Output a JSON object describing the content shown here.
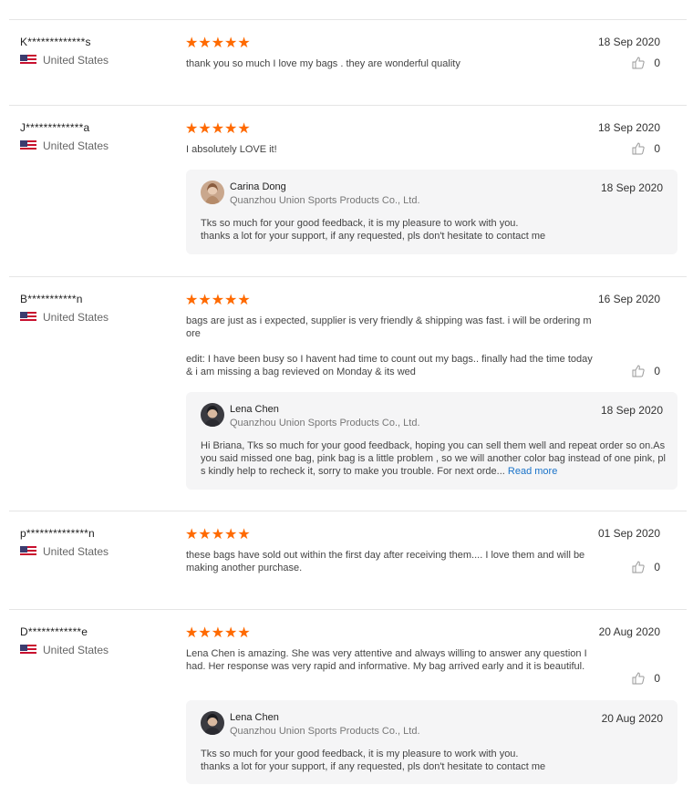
{
  "reviews": [
    {
      "buyer": "K*************s",
      "country": "United States",
      "stars": "★★★★★",
      "date": "18 Sep 2020",
      "text": [
        "thank you so much I love my bags . they are wonderful quality"
      ],
      "likes": "0"
    },
    {
      "buyer": "J*************a",
      "country": "United States",
      "stars": "★★★★★",
      "date": "18 Sep 2020",
      "text": [
        "I absolutely LOVE it!"
      ],
      "likes": "0",
      "reply": {
        "name": "Carina Dong",
        "company": "Quanzhou Union Sports Products Co., Ltd.",
        "date": "18 Sep 2020",
        "text": [
          "Tks so much for your good feedback, it is my pleasure to work with you.",
          "thanks a lot for your support, if any requested, pls don't hesitate to contact me"
        ]
      }
    },
    {
      "buyer": "B***********n",
      "country": "United States",
      "stars": "★★★★★",
      "date": "16 Sep 2020",
      "text": [
        "bags are just as i expected, supplier is very friendly & shipping was fast. i will be ordering more",
        "edit: I have been busy so I havent had time to count out my bags.. finally had the time today & i am missing a bag revieved on Monday & its wed"
      ],
      "likes": "0",
      "reply": {
        "name": "Lena Chen",
        "company": "Quanzhou Union Sports Products Co., Ltd.",
        "date": "18 Sep 2020",
        "text": [
          "Hi Briana, Tks so much for your good feedback, hoping you can sell them well and repeat order so on.As you said missed one bag, pink bag is a little problem , so we will another color bag instead of one pink,  pls kindly help to recheck it, sorry to make you trouble. For next orde..."
        ],
        "read_more": "Read more"
      }
    },
    {
      "buyer": "p**************n",
      "country": "United States",
      "stars": "★★★★★",
      "date": "01 Sep 2020",
      "text": [
        "these bags have sold out within the first day after receiving them.... I love them and will be making another purchase."
      ],
      "likes": "0"
    },
    {
      "buyer": "D************e",
      "country": "United States",
      "stars": "★★★★★",
      "date": "20 Aug 2020",
      "text": [
        "Lena Chen is amazing. She was very attentive and always willing to answer any question I had. Her response was very rapid and informative. My bag arrived early and it is beautiful."
      ],
      "likes": "0",
      "reply": {
        "name": "Lena Chen",
        "company": "Quanzhou Union Sports Products Co., Ltd.",
        "date": "20 Aug 2020",
        "text": [
          "Tks so much for your good feedback, it is my pleasure to work with you.",
          "thanks a lot for your support, if any requested, pls don't hesitate to contact me"
        ]
      }
    }
  ],
  "colors": {
    "star": "#ff6a00",
    "link": "#1a73c9",
    "reply_bg": "#f5f5f6"
  },
  "icons": {
    "like": "thumbs-up-icon",
    "flag": "us-flag-icon"
  }
}
